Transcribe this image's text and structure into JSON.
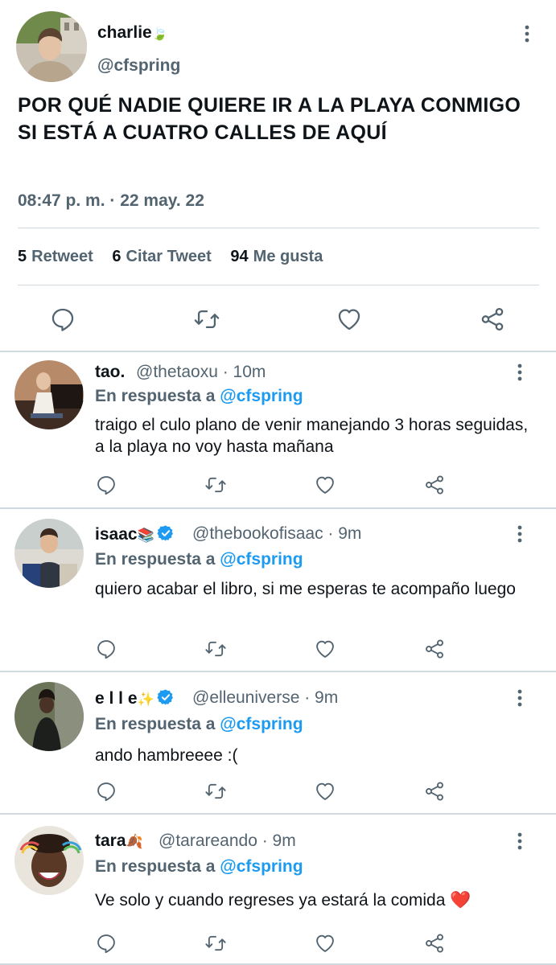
{
  "main_tweet": {
    "author_name": "charlie",
    "author_emoji": "🍃",
    "author_handle": "@cfspring",
    "text": "POR QUÉ NADIE QUIERE IR A LA PLAYA CONMIGO SI ESTÁ A CUATRO CALLES DE AQUÍ",
    "timestamp": "08:47 p. m. · 22 may. 22",
    "stats": {
      "retweets_count": "5",
      "retweets_label": "Retweet",
      "quotes_count": "6",
      "quotes_label": "Citar Tweet",
      "likes_count": "94",
      "likes_label": "Me gusta"
    }
  },
  "reply_prefix": "En respuesta a",
  "replies": [
    {
      "name": "tao.",
      "name_emoji": "",
      "verified": false,
      "handle_time": "@thetaoxu · 10m",
      "mention": "@cfspring",
      "text": "traigo el culo plano de venir manejando 3 horas seguidas, a la playa no voy hasta mañana"
    },
    {
      "name": "isaac",
      "name_emoji": "📚",
      "verified": true,
      "handle_time": "@thebookofisaac · 9m",
      "mention": "@cfspring",
      "text": "quiero acabar el libro, si me esperas te acompaño luego"
    },
    {
      "name": "e l l e",
      "name_emoji": "✨",
      "verified": true,
      "handle_time": "@elleuniverse · 9m",
      "mention": "@cfspring",
      "text": "ando hambreeee :("
    },
    {
      "name": "tara",
      "name_emoji": "🍂",
      "verified": false,
      "handle_time": "@tarareando · 9m",
      "mention": "@cfspring",
      "text": "Ve solo y cuando regreses ya estará la comida ❤️"
    }
  ],
  "colors": {
    "text_primary": "#0f1419",
    "text_secondary": "#536471",
    "accent": "#1d9bf0",
    "divider": "#cfd9de"
  },
  "icons": [
    "more-dots-icon",
    "reply-icon",
    "retweet-icon",
    "like-icon",
    "share-icon",
    "verified-badge-icon"
  ]
}
